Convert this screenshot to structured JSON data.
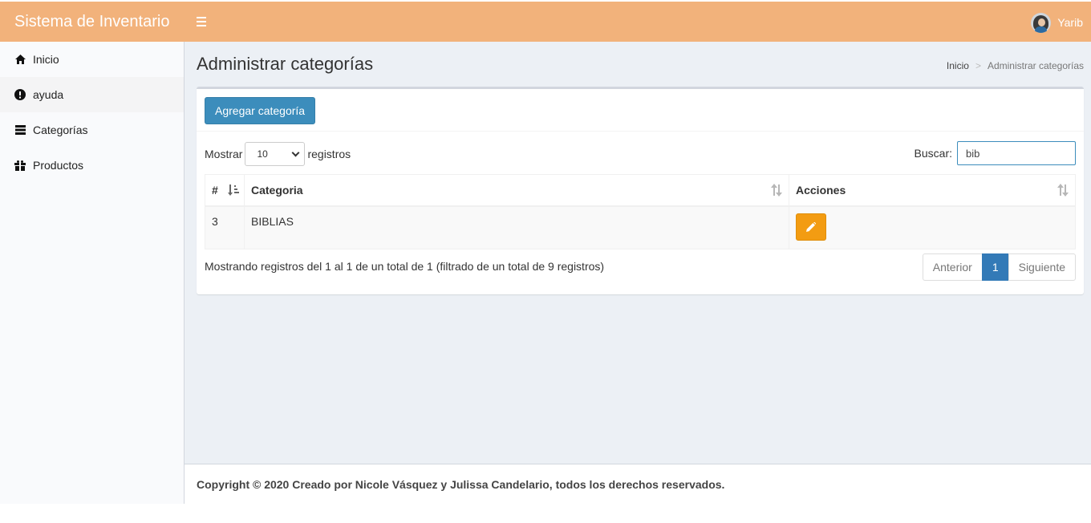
{
  "header": {
    "brand": "Sistema de Inventario",
    "user_name": "Yarib",
    "color": "#f2b27b"
  },
  "sidebar": {
    "items": [
      {
        "label": "Inicio",
        "icon": "home-icon"
      },
      {
        "label": "ayuda",
        "icon": "info-icon"
      },
      {
        "label": "Categorías",
        "icon": "list-icon"
      },
      {
        "label": "Productos",
        "icon": "gift-icon"
      }
    ]
  },
  "page": {
    "title": "Administrar categorías",
    "breadcrumb": {
      "home": "Inicio",
      "separator": ">",
      "current": "Administrar categorías"
    }
  },
  "toolbar": {
    "add_label": "Agregar categoría",
    "add_color": "#3c8dbc"
  },
  "table_controls": {
    "show_label": "Mostrar",
    "length_value": "10",
    "records_label": "registros",
    "search_label": "Buscar:",
    "search_value": "bib"
  },
  "table": {
    "columns": [
      "#",
      "Categoria",
      "Acciones"
    ],
    "rows": [
      {
        "id": "3",
        "category": "BIBLIAS",
        "action_color": "#f39c12"
      }
    ]
  },
  "info_text": "Mostrando registros del 1 al 1 de un total de 1 (filtrado de un total de 9 registros)",
  "pagination": {
    "prev": "Anterior",
    "current": "1",
    "next": "Siguiente"
  },
  "footer": {
    "text": "Copyright © 2020 Creado por Nicole Vásquez y Julissa Candelario, todos los derechos reservados."
  }
}
